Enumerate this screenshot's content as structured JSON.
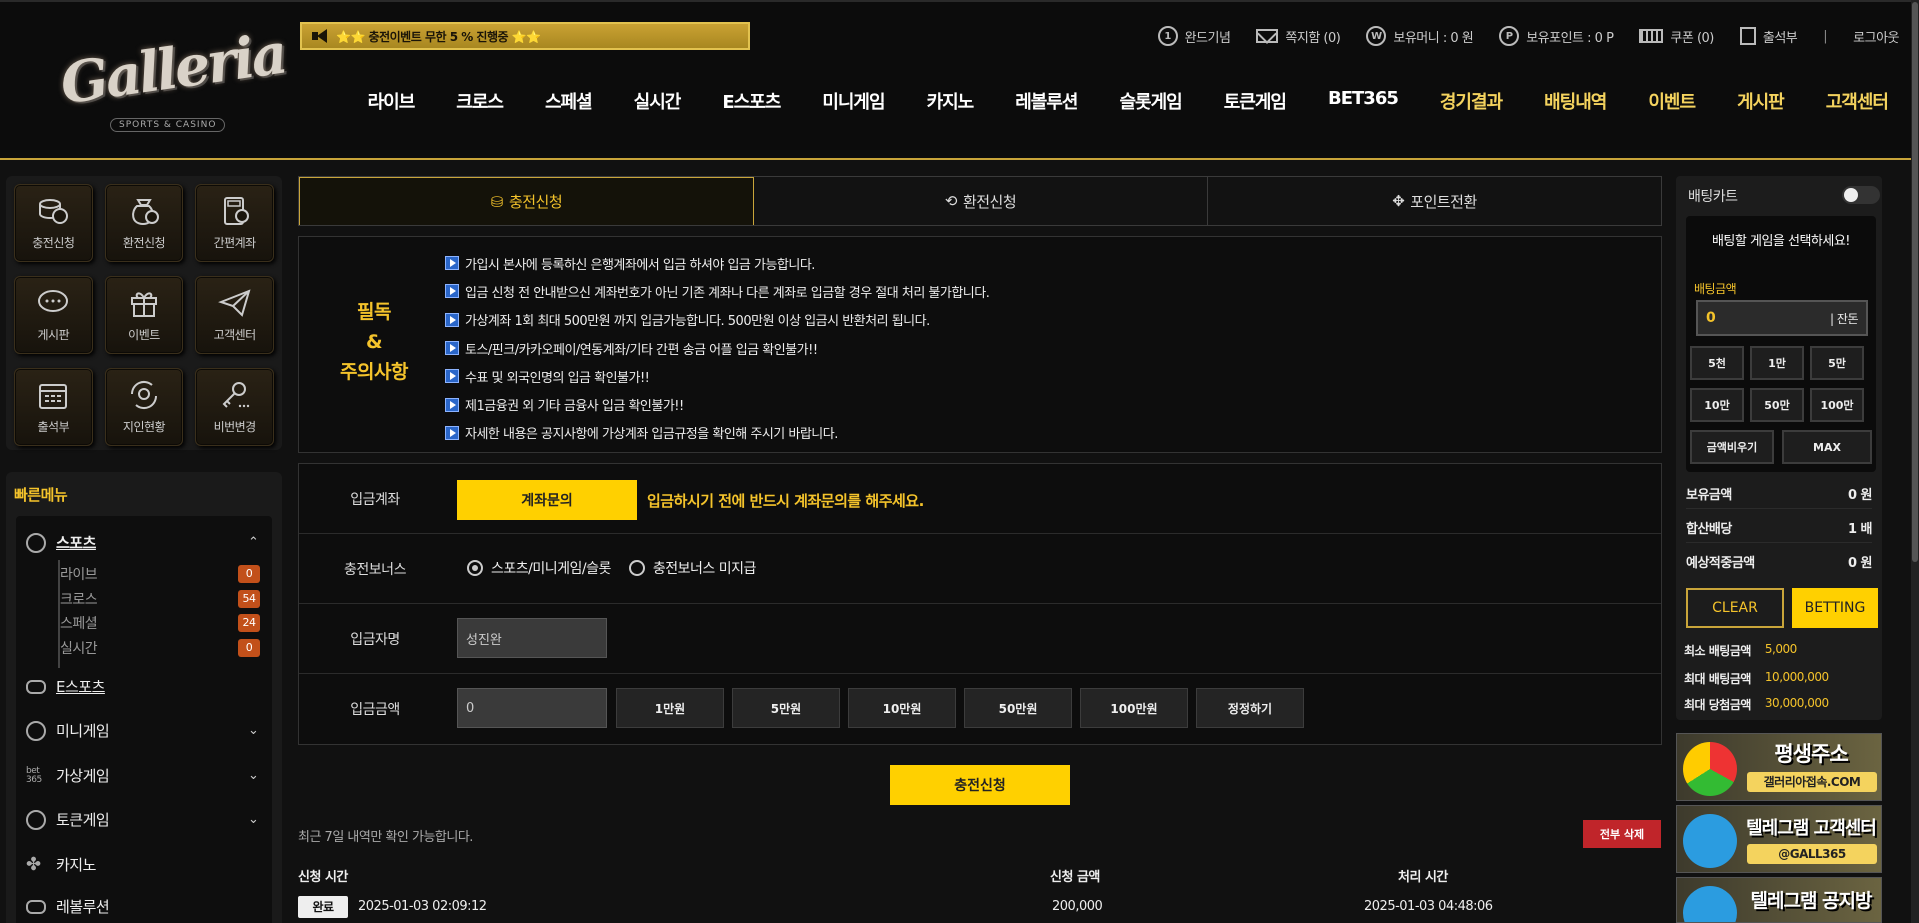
{
  "header": {
    "logo": "Galleria",
    "logo_sub": "SPORTS & CASINO",
    "notice": "⭐⭐ 충전이벤트 무한 5 % 진행중 ⭐⭐",
    "top_links": [
      {
        "icon": "number-1-icon",
        "label": "완드기념"
      },
      {
        "icon": "mail-icon",
        "label": "쪽지함 (0)"
      },
      {
        "icon": "won-icon",
        "label": "보유머니 : 0 원"
      },
      {
        "icon": "point-icon",
        "label": "보유포인트 : 0 P"
      },
      {
        "icon": "coupon-icon",
        "label": "쿠폰 (0)"
      },
      {
        "icon": "attendance-icon",
        "label": "출석부"
      }
    ],
    "separator": "|",
    "logout": "로그아웃",
    "nav": [
      {
        "label": "라이브",
        "gold": false
      },
      {
        "label": "크로스",
        "gold": false
      },
      {
        "label": "스페셜",
        "gold": false
      },
      {
        "label": "실시간",
        "gold": false
      },
      {
        "label": "E스포츠",
        "gold": false
      },
      {
        "label": "미니게임",
        "gold": false
      },
      {
        "label": "카지노",
        "gold": false
      },
      {
        "label": "레볼루션",
        "gold": false
      },
      {
        "label": "슬롯게임",
        "gold": false
      },
      {
        "label": "토큰게임",
        "gold": false
      },
      {
        "label": "BET365",
        "gold": false
      },
      {
        "label": "경기결과",
        "gold": true
      },
      {
        "label": "배팅내역",
        "gold": true
      },
      {
        "label": "이벤트",
        "gold": true
      },
      {
        "label": "게시판",
        "gold": true
      },
      {
        "label": "고객센터",
        "gold": true
      }
    ]
  },
  "left": {
    "quick_buttons": [
      {
        "icon": "coins-icon",
        "label": "충전신청"
      },
      {
        "icon": "money-bag-icon",
        "label": "환전신청"
      },
      {
        "icon": "calculator-icon",
        "label": "간편계좌"
      },
      {
        "icon": "chat-icon",
        "label": "게시판"
      },
      {
        "icon": "gift-icon",
        "label": "이벤트"
      },
      {
        "icon": "paper-plane-icon",
        "label": "고객센터"
      },
      {
        "icon": "calendar-icon",
        "label": "출석부"
      },
      {
        "icon": "referral-icon",
        "label": "지인현황"
      },
      {
        "icon": "key-icon",
        "label": "비번변경"
      }
    ],
    "quick_menu_title": "빠른메뉴",
    "menu": {
      "sports": "스포츠",
      "sports_sub": [
        {
          "label": "라이브",
          "count": "0"
        },
        {
          "label": "크로스",
          "count": "54"
        },
        {
          "label": "스페셜",
          "count": "24"
        },
        {
          "label": "실시간",
          "count": "0"
        }
      ],
      "esports": "E스포츠",
      "minigame": "미니게임",
      "virtual": "가상게임",
      "token": "토큰게임",
      "casino": "카지노",
      "revolution": "레볼루션"
    }
  },
  "main": {
    "tabs": [
      "충전신청",
      "환전신청",
      "포인트전환"
    ],
    "notice_title_1": "필독",
    "notice_title_2": "&",
    "notice_title_3": "주의사항",
    "notices": [
      "가입시 본사에 등록하신 은행계좌에서 입금 하셔야 입금 가능합니다.",
      "입금 신청 전 안내받으신 계좌번호가 아닌 기존 계좌나 다른 계좌로 입금할 경우 절대 처리 불가합니다.",
      "가상계좌 1회 최대 500만원 까지 입금가능합니다. 500만원 이상 입금시 반환처리 됩니다.",
      "토스/핀크/카카오페이/연동계좌/기타 간편 송금 어플 입금 확인불가!!",
      "수표 및 외국인명의 입금 확인불가!!",
      "제1금융권 외 기타 금융사 입금 확인불가!!",
      "자세한 내용은 공지사항에 가상계좌 입금규정을 확인해 주시기 바랍니다."
    ],
    "form": {
      "account_label": "입금계좌",
      "account_btn": "계좌문의",
      "account_note": "입금하시기 전에 반드시 계좌문의를 해주세요.",
      "bonus_label": "충전보너스",
      "bonus_opt1": "스포츠/미니게임/슬롯",
      "bonus_opt2": "충전보너스 미지급",
      "name_label": "입금자명",
      "name_value": "성진완",
      "amount_label": "입금금액",
      "amount_value": "0",
      "amount_buttons": [
        "1만원",
        "5만원",
        "10만원",
        "50만원",
        "100만원",
        "정정하기"
      ]
    },
    "submit": "충전신청",
    "history_note": "최근 7일 내역만 확인 가능합니다.",
    "delete_all": "전부 삭제",
    "table": {
      "headers": [
        "신청 시간",
        "신청 금액",
        "처리 시간"
      ],
      "rows": [
        {
          "status": "완료",
          "requested": "2025-01-03 02:09:12",
          "amount": "200,000",
          "processed": "2025-01-03 04:48:06"
        }
      ]
    }
  },
  "right": {
    "title": "배팅카트",
    "select_msg": "배팅할 게임을 선택하세요!",
    "amount_label": "배팅금액",
    "amount_value": "0",
    "remainder": "| 잔돈",
    "chips": [
      "5천",
      "1만",
      "5만",
      "10만",
      "50만",
      "100만"
    ],
    "clear_amount": "금액비우기",
    "max": "MAX",
    "stats": [
      {
        "k": "보유금액",
        "v": "0 원"
      },
      {
        "k": "합산배당",
        "v": "1 배"
      },
      {
        "k": "예상적중금액",
        "v": "0 원"
      }
    ],
    "clear": "CLEAR",
    "betting": "BETTING",
    "limits": [
      {
        "k": "최소 배팅금액",
        "v": "5,000"
      },
      {
        "k": "최대 배팅금액",
        "v": "10,000,000"
      },
      {
        "k": "최대 당첨금액",
        "v": "30,000,000"
      }
    ],
    "banners": [
      {
        "icon": "chrome-icon",
        "main": "평생주소",
        "sub": "갤러리아접속.COM"
      },
      {
        "icon": "telegram-icon",
        "main": "텔레그램 고객센터",
        "sub": "@GALL365"
      },
      {
        "icon": "telegram-icon",
        "main": "텔레그램 공지방",
        "sub": ""
      }
    ]
  },
  "colors": {
    "gold": "#f4c32b",
    "yellow_button": "#ffd000",
    "delete_red": "#c0252a",
    "count_badge": "#c2501a"
  }
}
